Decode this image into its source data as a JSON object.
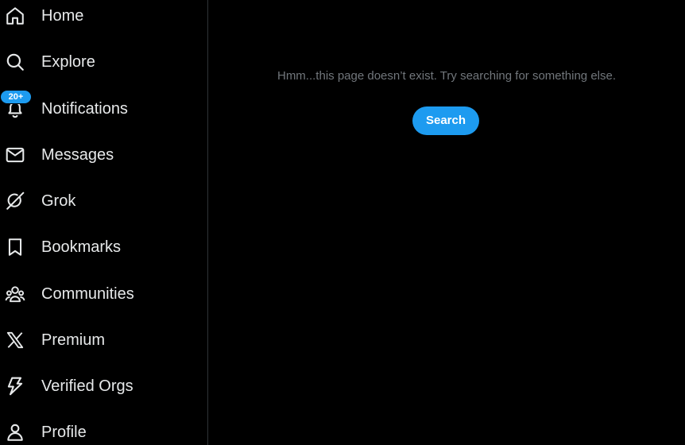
{
  "sidebar": {
    "items": [
      {
        "label": "Home",
        "icon": "home-icon"
      },
      {
        "label": "Explore",
        "icon": "search-icon"
      },
      {
        "label": "Notifications",
        "icon": "bell-icon",
        "badge": "20+"
      },
      {
        "label": "Messages",
        "icon": "envelope-icon"
      },
      {
        "label": "Grok",
        "icon": "grok-icon"
      },
      {
        "label": "Bookmarks",
        "icon": "bookmark-icon"
      },
      {
        "label": "Communities",
        "icon": "communities-icon"
      },
      {
        "label": "Premium",
        "icon": "x-logo-icon"
      },
      {
        "label": "Verified Orgs",
        "icon": "lightning-icon"
      },
      {
        "label": "Profile",
        "icon": "person-icon"
      }
    ]
  },
  "main": {
    "message": "Hmm...this page doesn’t exist. Try searching for something else.",
    "search_button_label": "Search"
  },
  "colors": {
    "background": "#000000",
    "accent": "#1d9bf0",
    "text_primary": "#e7e9ea",
    "text_secondary": "#71767b",
    "divider": "#2f3336"
  }
}
